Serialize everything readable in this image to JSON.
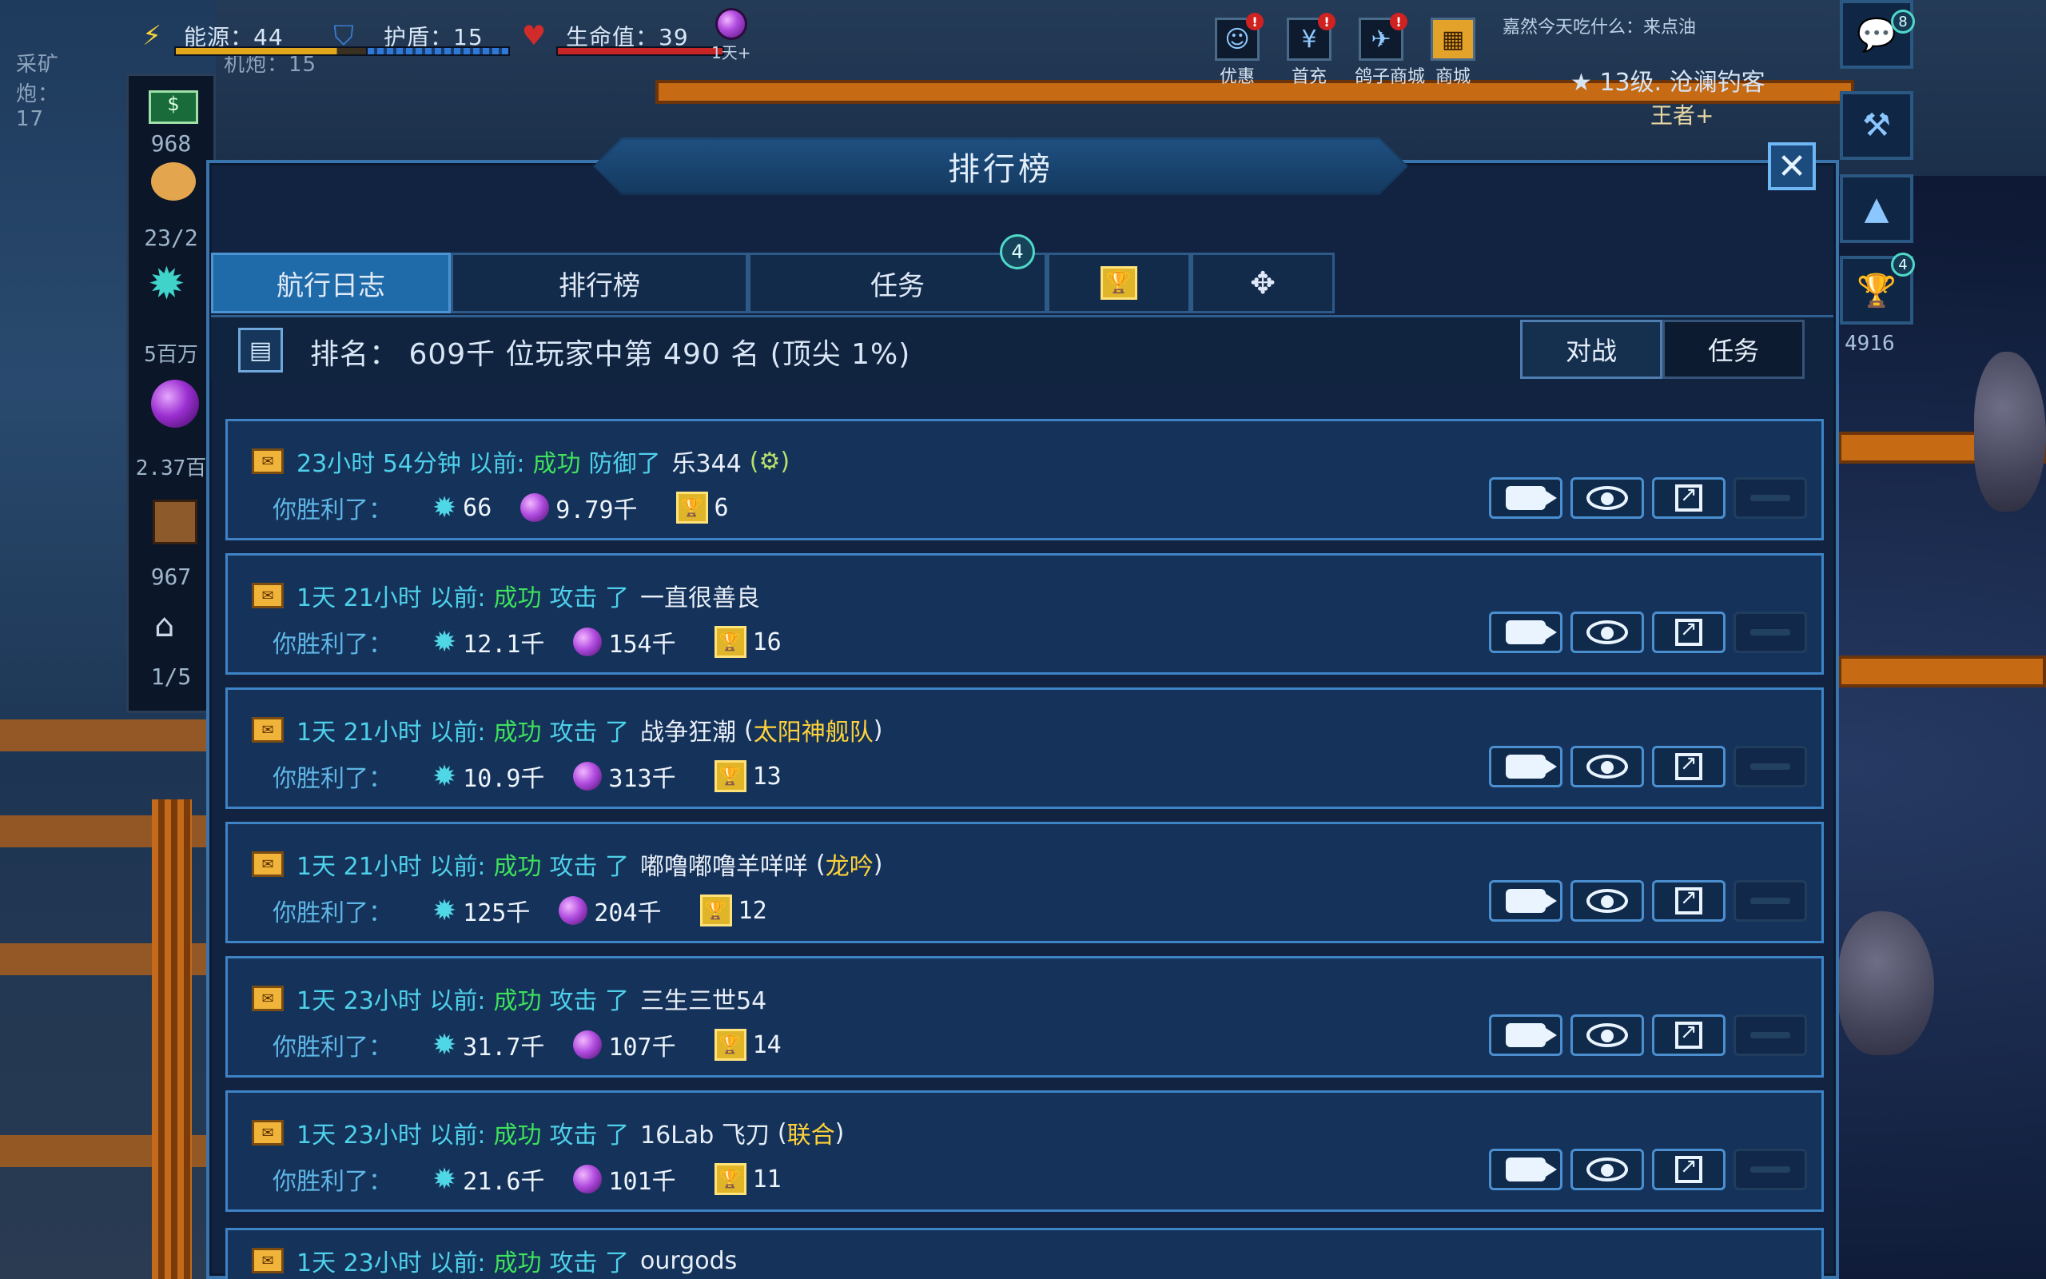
{
  "hud": {
    "energy_label": "能源：44",
    "shield_label": "护盾：15",
    "health_label": "生命值：39",
    "orb_caption": "1天+",
    "mining_label": "采矿炮：17",
    "cannon_label": "机炮：15",
    "left_stats": [
      "968",
      "23/2",
      "5百万",
      "2.37百",
      "967",
      "1/5"
    ],
    "chat_text": "嘉然今天吃什么：来点油",
    "player_level": "13级. 沧澜钓客",
    "player_rank": "王者+",
    "side_badge_chat": "8",
    "side_badge_trophy": "4",
    "side_trophy_count": "4916",
    "top_icons": [
      {
        "label": "优惠",
        "icon": "face-icon",
        "badge": "!"
      },
      {
        "label": "首充",
        "icon": "yen-icon",
        "badge": "!"
      },
      {
        "label": "鸽子商城",
        "icon": "bird-icon",
        "badge": "!"
      },
      {
        "label": "商城",
        "icon": "shop-icon",
        "badge": ""
      }
    ]
  },
  "modal": {
    "title": "排行榜",
    "tabs": [
      "航行日志",
      "排行榜",
      "任务"
    ],
    "tab_badge": "4",
    "rank_text": "排名：  609千 位玩家中第 490 名  (顶尖 1%)",
    "sub_tabs": [
      "对战",
      "任务"
    ],
    "loot_label": "你胜利了：",
    "logs": [
      {
        "time": "23小时 54分钟 以前:",
        "result": "成功",
        "action": "防御了",
        "opponent": "乐344",
        "guild": "(⚙)",
        "crystals": "66",
        "orbs": "9.79千",
        "trophies": "6"
      },
      {
        "time": "1天 21小时 以前:",
        "result": "成功",
        "action": "攻击 了",
        "opponent": "一直很善良",
        "guild": "",
        "crystals": "12.1千",
        "orbs": "154千",
        "trophies": "16"
      },
      {
        "time": "1天 21小时 以前:",
        "result": "成功",
        "action": "攻击 了",
        "opponent": "战争狂潮",
        "guild": "太阳神舰队",
        "crystals": "10.9千",
        "orbs": "313千",
        "trophies": "13"
      },
      {
        "time": "1天 21小时 以前:",
        "result": "成功",
        "action": "攻击 了",
        "opponent": "嘟噜嘟噜羊咩咩",
        "guild": "龙吟",
        "crystals": "125千",
        "orbs": "204千",
        "trophies": "12"
      },
      {
        "time": "1天 23小时 以前:",
        "result": "成功",
        "action": "攻击 了",
        "opponent": "三生三世54",
        "guild": "",
        "crystals": "31.7千",
        "orbs": "107千",
        "trophies": "14"
      },
      {
        "time": "1天 23小时 以前:",
        "result": "成功",
        "action": "攻击 了",
        "opponent": "16Lab 飞刀",
        "guild": "联合",
        "crystals": "21.6千",
        "orbs": "101千",
        "trophies": "11"
      }
    ],
    "partial_log": {
      "time": "1天 23小时 以前:",
      "result": "成功",
      "action": "攻击 了",
      "opponent": "ourgods"
    }
  }
}
